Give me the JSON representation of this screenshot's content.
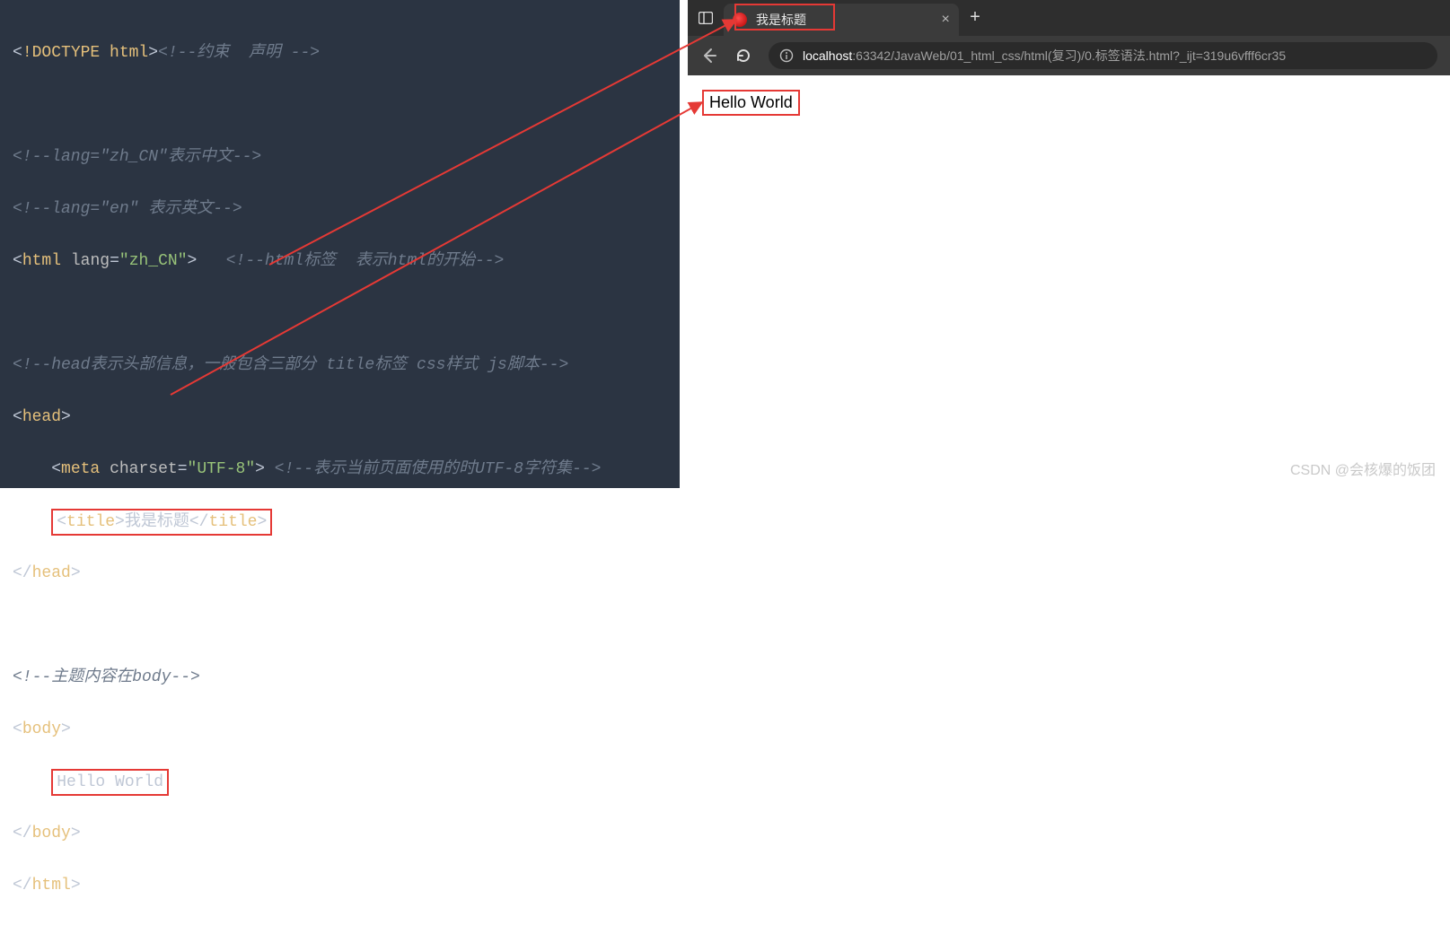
{
  "code": {
    "l1_doctype": "!DOCTYPE html",
    "l1_cmt": "<!--约束  声明 -->",
    "l3_cmt": "<!--lang=\"zh_CN\"表示中文-->",
    "l4_cmt": "<!--lang=\"en\" 表示英文-->",
    "l5_tag": "html",
    "l5_attr": "lang",
    "l5_val": "zh_CN",
    "l5_cmt": "<!--html标签  表示html的开始-->",
    "l7_cmt": "<!--head表示头部信息，一般包含三部分 title标签 css样式 js脚本-->",
    "l8_tag": "head",
    "l9_tag": "meta",
    "l9_attr": "charset",
    "l9_val": "UTF-8",
    "l9_cmt": "<!--表示当前页面使用的时UTF-8字符集-->",
    "l10_tag": "title",
    "l10_text": "我是标题",
    "l11_tag_close": "head",
    "l13_cmt": "<!--主题内容在body-->",
    "l14_tag": "body",
    "l15_text": "Hello World",
    "l16_tag_close": "body",
    "l17_tag_close": "html"
  },
  "browser": {
    "tab_title": "我是标题",
    "url_host": "localhost",
    "url_path": ":63342/JavaWeb/01_html_css/html(复习)/0.标签语法.html?_ijt=319u6vfff6cr35",
    "page_text": "Hello World"
  },
  "watermark": "CSDN @会核爆的饭团"
}
